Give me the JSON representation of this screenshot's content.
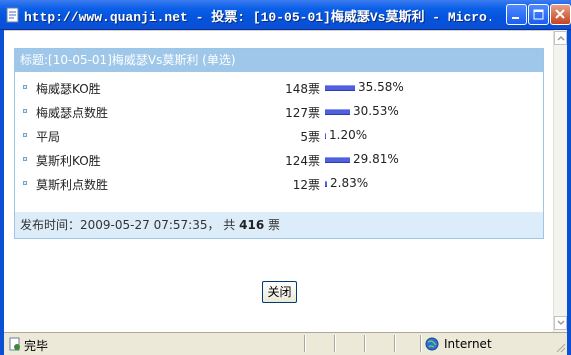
{
  "window": {
    "title": "http://www.quanji.net - 投票: [10-05-01]梅威瑟Vs莫斯利 - Micro..."
  },
  "poll": {
    "header": "标题:[10-05-01]梅威瑟Vs莫斯利 (单选)",
    "bar_color": "#4f5fe0",
    "options": [
      {
        "label": "梅威瑟KO胜",
        "votes": "148票",
        "percent": "35.58%",
        "fraction": 0.3558
      },
      {
        "label": "梅威瑟点数胜",
        "votes": "127票",
        "percent": "30.53%",
        "fraction": 0.3053
      },
      {
        "label": "平局",
        "votes": "5票",
        "percent": "1.20%",
        "fraction": 0.012
      },
      {
        "label": "莫斯利KO胜",
        "votes": "124票",
        "percent": "29.81%",
        "fraction": 0.2981
      },
      {
        "label": "莫斯利点数胜",
        "votes": "12票",
        "percent": "2.83%",
        "fraction": 0.0283
      }
    ],
    "footer": {
      "published_label": "发布时间：",
      "published_time": "2009-05-27 07:57:35",
      "total_prefix": "， 共",
      "total_count": "416",
      "total_suffix": "票"
    }
  },
  "close_button": {
    "label": "关闭"
  },
  "statusbar": {
    "status": "完毕",
    "zone": "Internet"
  },
  "colors": {
    "titlebar": "#0554dd",
    "panel_header": "#9ec7ea",
    "panel_footer": "#dcecf8"
  }
}
